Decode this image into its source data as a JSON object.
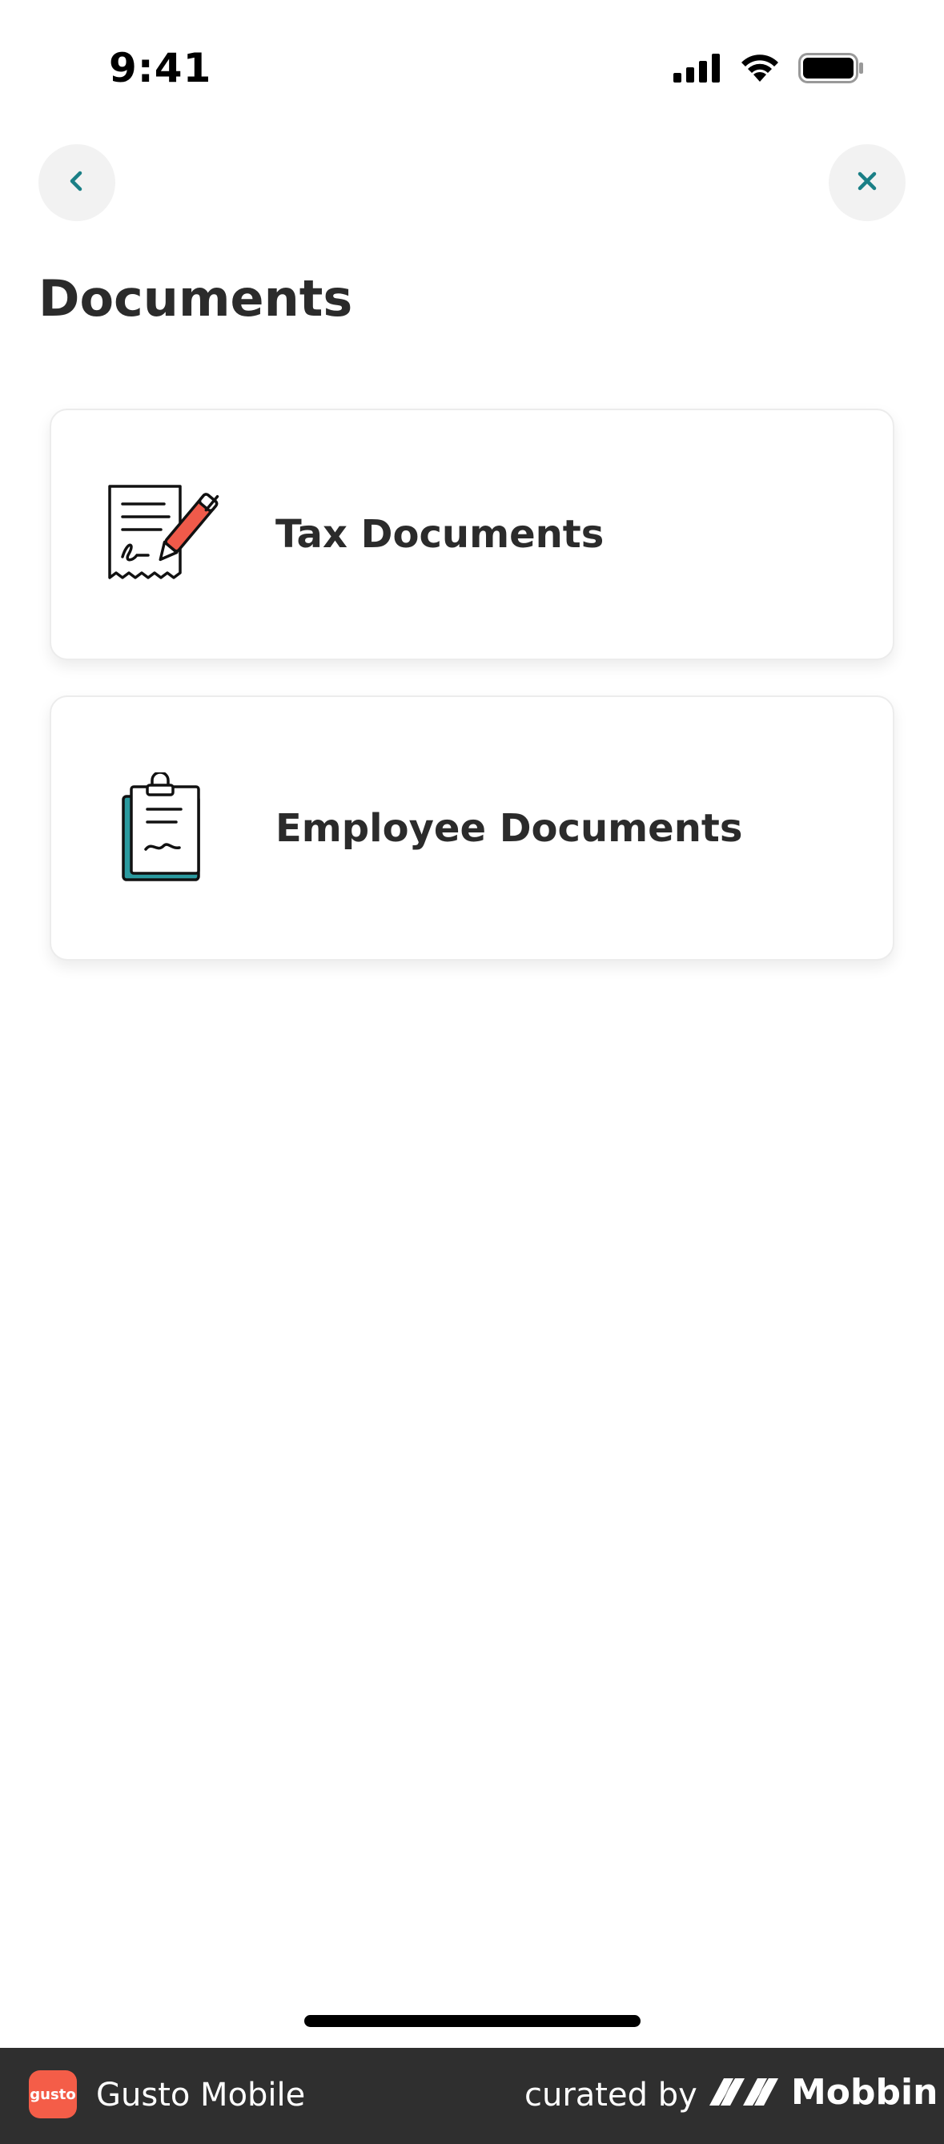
{
  "status_bar": {
    "time": "9:41",
    "icons": [
      "cellular-signal-icon",
      "wifi-icon",
      "battery-icon"
    ]
  },
  "nav": {
    "back_icon": "chevron-left-icon",
    "close_icon": "close-icon",
    "accent_color": "#1a7f86"
  },
  "page": {
    "title": "Documents"
  },
  "cards": [
    {
      "label": "Tax Documents",
      "icon": "signed-receipt-pen-icon"
    },
    {
      "label": "Employee Documents",
      "icon": "clipboard-document-icon"
    }
  ],
  "footer": {
    "app_logo_text": "gusto",
    "app_name": "Gusto Mobile",
    "curated_by": "curated by",
    "brand": "Mobbin",
    "brand_logo_icon": "mobbin-logo-icon",
    "app_logo_color": "#f45d48",
    "bar_color": "#2f2f2f"
  }
}
